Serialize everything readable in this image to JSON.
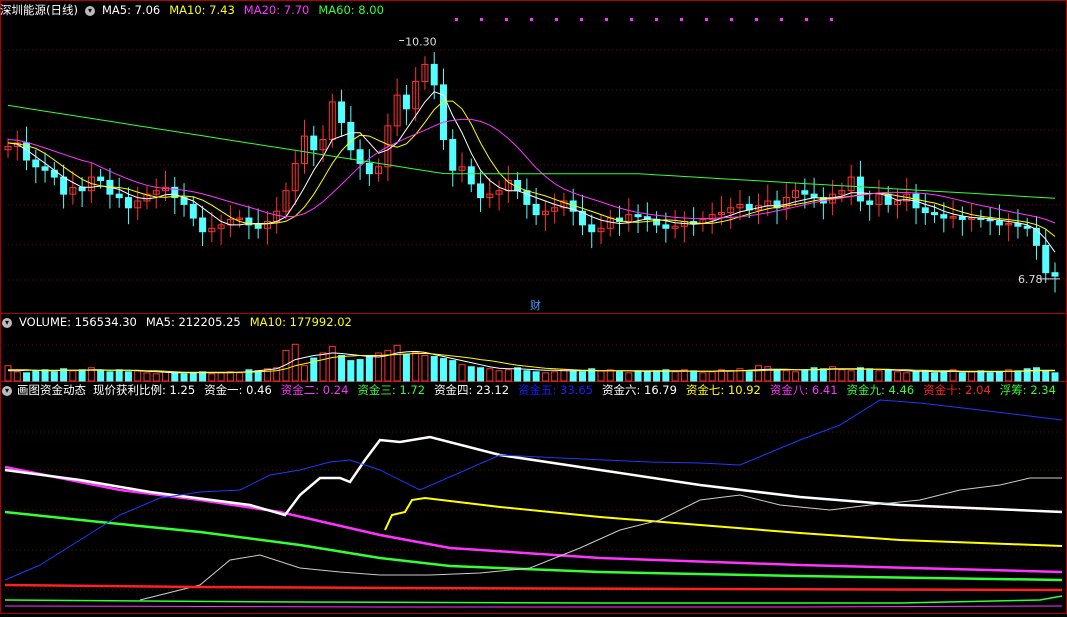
{
  "price_header": {
    "title": "深圳能源(日线)",
    "indicators": [
      {
        "label": "MA5: 7.06",
        "color": "#ffffff"
      },
      {
        "label": "MA10: 7.43",
        "color": "#ffff00"
      },
      {
        "label": "MA20: 7.70",
        "color": "#ff33ff"
      },
      {
        "label": "MA60: 8.00",
        "color": "#33ff33"
      }
    ]
  },
  "volume_header": {
    "indicators": [
      {
        "label": "VOLUME: 156534.30",
        "color": "#ffffff"
      },
      {
        "label": "MA5: 212205.25",
        "color": "#ffffff"
      },
      {
        "label": "MA10: 177992.02",
        "color": "#ffff00"
      }
    ]
  },
  "fund_header": {
    "title": "画图资金动态",
    "indicators": [
      {
        "label": "现价获利比例: 1.25",
        "color": "#ffffff",
        "bg": ""
      },
      {
        "label": "资金一: 0.46",
        "color": "#ffffff",
        "bg": ""
      },
      {
        "label": "资金二: 0.24",
        "color": "#ff33ff",
        "bg": ""
      },
      {
        "label": "资金三: 1.72",
        "color": "#33ff33",
        "bg": ""
      },
      {
        "label": "资金四: 23.12",
        "color": "#ffffff",
        "bg": ""
      },
      {
        "label": "资金五: 33.65",
        "color": "#1a1aff",
        "bg": ""
      },
      {
        "label": "资金六: 16.79",
        "color": "#ffffff",
        "bg": ""
      },
      {
        "label": "资金七: 10.92",
        "color": "#ffff00",
        "bg": ""
      },
      {
        "label": "资金八: 6.41",
        "color": "#ff33ff",
        "bg": ""
      },
      {
        "label": "资金九: 4.46",
        "color": "#33ff33",
        "bg": ""
      },
      {
        "label": "资金十: 2.04",
        "color": "#ff2020",
        "bg": ""
      },
      {
        "label": "浮筹: 2.34",
        "color": "#33ff33",
        "bg": ""
      }
    ]
  },
  "annotations": {
    "high_label": "10.30",
    "low_label": "6.78",
    "cai_marker": "财"
  },
  "colors": {
    "up": "#ff3232",
    "down": "#54ffff",
    "grid": "#7a0000",
    "border": "#b00000"
  },
  "chart_data": [
    {
      "type": "candlestick",
      "name": "price",
      "ylim": [
        6.5,
        10.6
      ],
      "closes": [
        8.75,
        8.8,
        8.55,
        8.45,
        8.4,
        8.3,
        8.05,
        8.15,
        8.1,
        8.3,
        8.25,
        8.05,
        8.0,
        7.85,
        7.95,
        8.05,
        8.1,
        8.15,
        8.0,
        7.9,
        7.7,
        7.5,
        7.55,
        7.6,
        7.68,
        7.7,
        7.6,
        7.55,
        7.65,
        7.8,
        8.1,
        8.5,
        8.9,
        8.7,
        8.85,
        9.4,
        9.1,
        8.7,
        8.5,
        8.35,
        8.45,
        9.05,
        9.5,
        9.3,
        9.7,
        9.95,
        9.65,
        8.85,
        8.4,
        8.45,
        8.2,
        8.0,
        8.05,
        8.1,
        8.25,
        8.1,
        7.9,
        7.75,
        7.8,
        7.85,
        7.95,
        7.8,
        7.6,
        7.5,
        7.55,
        7.7,
        7.65,
        7.75,
        7.72,
        7.68,
        7.6,
        7.55,
        7.58,
        7.65,
        7.62,
        7.68,
        7.75,
        7.78,
        7.85,
        7.9,
        7.82,
        7.88,
        7.95,
        7.85,
        8.0,
        8.1,
        8.05,
        8.0,
        7.92,
        8.05,
        8.1,
        8.3,
        7.95,
        7.9,
        8.05,
        7.9,
        7.95,
        8.05,
        7.85,
        7.78,
        7.75,
        7.7,
        7.72,
        7.68,
        7.7,
        7.68,
        7.66,
        7.6,
        7.62,
        7.58,
        7.55,
        7.3,
        6.9,
        6.85
      ],
      "opens": [
        8.7,
        8.75,
        8.8,
        8.55,
        8.45,
        8.4,
        8.3,
        8.05,
        8.15,
        8.1,
        8.3,
        8.25,
        8.05,
        8.0,
        7.85,
        7.95,
        8.05,
        8.1,
        8.15,
        8.0,
        7.9,
        7.7,
        7.5,
        7.55,
        7.6,
        7.68,
        7.7,
        7.6,
        7.55,
        7.65,
        7.8,
        8.1,
        8.5,
        8.9,
        8.7,
        8.85,
        9.4,
        9.1,
        8.7,
        8.5,
        8.35,
        8.45,
        9.05,
        9.5,
        9.3,
        9.7,
        9.95,
        9.65,
        8.85,
        8.4,
        8.45,
        8.2,
        8.0,
        8.05,
        8.1,
        8.25,
        8.1,
        7.9,
        7.75,
        7.8,
        7.85,
        7.95,
        7.8,
        7.6,
        7.5,
        7.55,
        7.7,
        7.65,
        7.75,
        7.72,
        7.68,
        7.6,
        7.55,
        7.58,
        7.65,
        7.62,
        7.68,
        7.75,
        7.78,
        7.85,
        7.9,
        7.82,
        7.88,
        7.95,
        7.85,
        8.0,
        8.1,
        8.05,
        8.0,
        7.92,
        8.05,
        8.1,
        8.3,
        7.95,
        7.9,
        8.05,
        7.9,
        7.95,
        8.05,
        7.85,
        7.78,
        7.75,
        7.7,
        7.72,
        7.68,
        7.7,
        7.68,
        7.66,
        7.6,
        7.62,
        7.58,
        7.55,
        7.3,
        6.9
      ],
      "high": 10.3,
      "low": 6.78,
      "ma5": [
        8.8,
        8.78,
        8.7,
        8.6,
        8.5,
        8.4,
        8.3,
        8.22,
        8.15,
        8.15,
        8.17,
        8.15,
        8.12,
        8.05,
        8.0,
        7.98,
        8.0,
        8.04,
        8.05,
        8.0,
        7.95,
        7.85,
        7.75,
        7.65,
        7.6,
        7.6,
        7.62,
        7.62,
        7.62,
        7.65,
        7.72,
        7.92,
        8.15,
        8.4,
        8.6,
        8.85,
        8.9,
        8.95,
        8.95,
        8.8,
        8.65,
        8.7,
        8.8,
        9.0,
        9.2,
        9.4,
        9.55,
        9.5,
        9.2,
        8.95,
        8.65,
        8.4,
        8.25,
        8.15,
        8.1,
        8.1,
        8.05,
        8.0,
        7.95,
        7.9,
        7.86,
        7.83,
        7.78,
        7.72,
        7.67,
        7.64,
        7.62,
        7.63,
        7.66,
        7.69,
        7.68,
        7.66,
        7.63,
        7.62,
        7.61,
        7.62,
        7.65,
        7.7,
        7.74,
        7.79,
        7.82,
        7.85,
        7.88,
        7.88,
        7.9,
        7.94,
        7.97,
        8.0,
        7.99,
        8.0,
        8.02,
        8.07,
        8.07,
        8.06,
        8.06,
        8.02,
        7.96,
        7.97,
        7.95,
        7.9,
        7.86,
        7.8,
        7.76,
        7.73,
        7.71,
        7.7,
        7.69,
        7.67,
        7.65,
        7.63,
        7.6,
        7.53,
        7.39,
        7.2
      ]
    },
    {
      "type": "bar",
      "name": "volume",
      "ylim": [
        0,
        100
      ],
      "values": [
        30,
        18,
        16,
        20,
        22,
        18,
        24,
        20,
        22,
        26,
        20,
        18,
        22,
        18,
        20,
        16,
        14,
        18,
        16,
        14,
        16,
        18,
        14,
        16,
        18,
        16,
        22,
        20,
        24,
        26,
        60,
        72,
        30,
        45,
        55,
        68,
        50,
        40,
        42,
        48,
        55,
        60,
        70,
        52,
        56,
        50,
        48,
        44,
        40,
        32,
        28,
        26,
        24,
        20,
        22,
        26,
        20,
        18,
        16,
        18,
        22,
        20,
        18,
        24,
        20,
        22,
        18,
        16,
        20,
        18,
        20,
        22,
        18,
        22,
        20,
        16,
        18,
        22,
        20,
        24,
        18,
        30,
        28,
        22,
        20,
        18,
        22,
        26,
        24,
        28,
        22,
        20,
        26,
        24,
        20,
        22,
        18,
        16,
        18,
        20,
        16,
        18,
        22,
        16,
        18,
        20,
        16,
        18,
        22,
        20,
        24,
        26,
        20,
        16
      ],
      "ma5": [
        20,
        20,
        21,
        21,
        20,
        20,
        21,
        21,
        21,
        22,
        22,
        21,
        21,
        21,
        20,
        19,
        18,
        17,
        16,
        16,
        16,
        16,
        16,
        16,
        16,
        17,
        18,
        20,
        22,
        24,
        32,
        42,
        46,
        50,
        52,
        55,
        54,
        52,
        50,
        48,
        47,
        50,
        55,
        57,
        58,
        56,
        52,
        48,
        44,
        40,
        36,
        32,
        28,
        25,
        24,
        24,
        23,
        22,
        21,
        21,
        20,
        20,
        20,
        20,
        20,
        20,
        20,
        20,
        19,
        19,
        19,
        19,
        19,
        19,
        19,
        19,
        19,
        20,
        20,
        20,
        21,
        22,
        23,
        23,
        23,
        22,
        22,
        22,
        23,
        24,
        24,
        24,
        24,
        23,
        23,
        22,
        21,
        20,
        19,
        19,
        18,
        18,
        19,
        18,
        18,
        18,
        18,
        18,
        19,
        19,
        20,
        21,
        21,
        21
      ],
      "ma10": [
        22,
        22,
        22,
        21,
        21,
        21,
        21,
        21,
        21,
        21,
        21,
        21,
        21,
        21,
        21,
        20,
        20,
        19,
        18,
        17,
        17,
        17,
        17,
        17,
        17,
        17,
        17,
        18,
        19,
        20,
        24,
        30,
        34,
        38,
        42,
        46,
        48,
        49,
        50,
        50,
        50,
        51,
        52,
        53,
        54,
        54,
        53,
        51,
        49,
        47,
        45,
        42,
        40,
        37,
        34,
        31,
        29,
        27,
        25,
        24,
        23,
        22,
        21,
        21,
        20,
        20,
        20,
        20,
        20,
        20,
        20,
        20,
        20,
        20,
        19,
        19,
        19,
        19,
        19,
        20,
        20,
        20,
        21,
        21,
        22,
        22,
        22,
        22,
        22,
        23,
        23,
        23,
        23,
        23,
        23,
        23,
        22,
        22,
        21,
        21,
        20,
        20,
        20,
        19,
        19,
        19,
        19,
        19,
        19,
        19,
        19,
        20,
        20,
        20
      ]
    },
    {
      "type": "line",
      "name": "fund-dynamics",
      "ylim": [
        0,
        100
      ]
    }
  ]
}
